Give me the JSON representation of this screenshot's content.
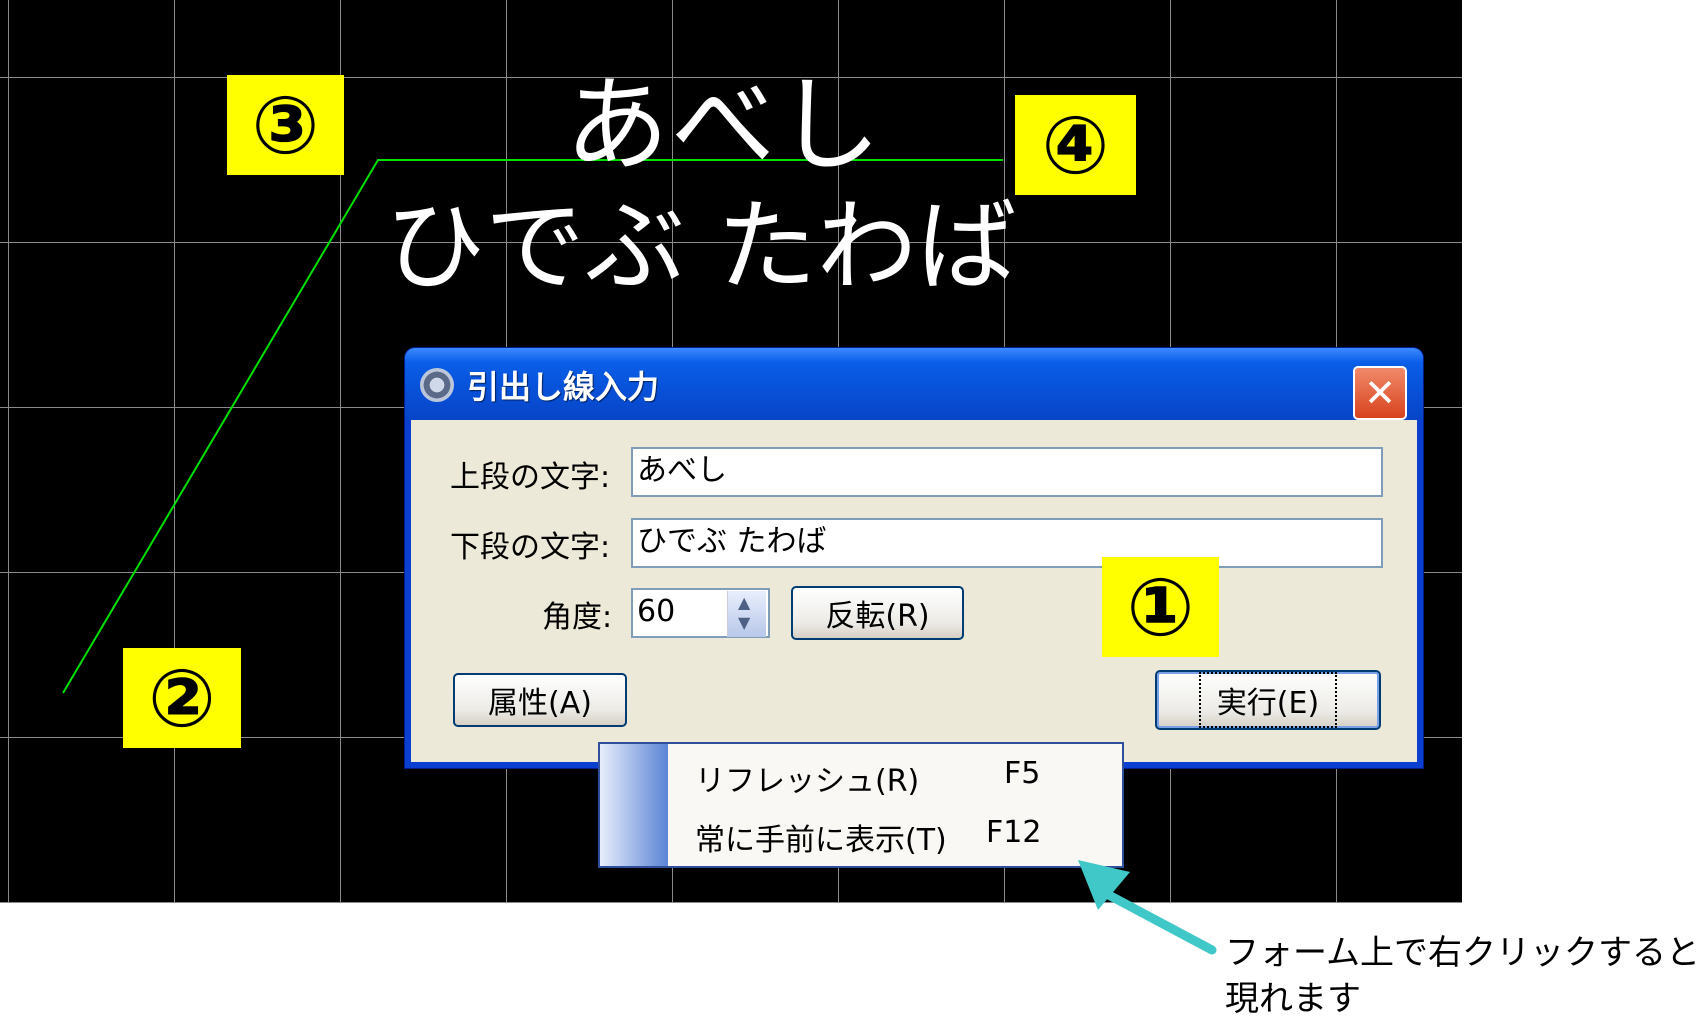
{
  "cad": {
    "upper_text": "あべし",
    "lower_text": "ひでぶ たわば"
  },
  "badges": {
    "one": "①",
    "two": "②",
    "three": "③",
    "four": "④"
  },
  "colors": {
    "canvas_bg": "#000000",
    "leader_line": "#00e000",
    "badge_bg": "#ffff00",
    "arrow": "#40c8c8"
  },
  "dialog": {
    "title": "引出し線入力",
    "close_glyph": "✕",
    "upper_label": "上段の文字:",
    "upper_value": "あべし",
    "lower_label": "下段の文字:",
    "lower_value": "ひでぶ たわば",
    "angle_label": "角度:",
    "angle_value": "60",
    "reverse_button": "反転(R)",
    "attribute_button": "属性(A)",
    "execute_button": "実行(E)"
  },
  "context_menu": {
    "items": [
      {
        "label": "リフレッシュ(R)",
        "shortcut": "F5"
      },
      {
        "label": "常に手前に表示(T)",
        "shortcut": "F12"
      }
    ]
  },
  "annotation": {
    "line1": "フォーム上で右クリックすると",
    "line2": "現れます"
  }
}
